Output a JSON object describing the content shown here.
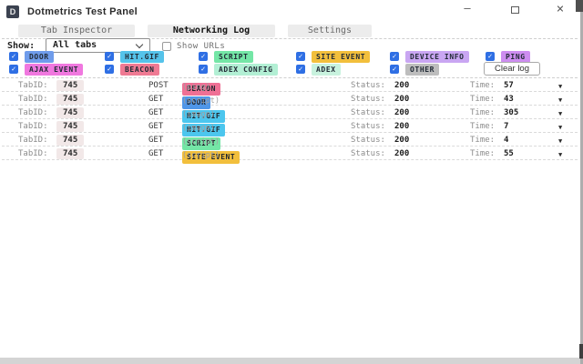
{
  "window": {
    "title": "Dotmetrics Test Panel",
    "icon_letter": "D",
    "controls": {
      "minimize": "—",
      "close": "×"
    }
  },
  "tabs": [
    {
      "label": "Tab Inspector"
    },
    {
      "label": "Networking Log"
    },
    {
      "label": "Settings"
    }
  ],
  "toolbar": {
    "show_label": "Show:",
    "show_select_value": "All tabs",
    "show_urls_label": "Show URLs",
    "clear_log_label": "Clear log",
    "checkmark": "✓"
  },
  "filters": {
    "row1": [
      {
        "label": "DOOR",
        "color": "#6f9ceb"
      },
      {
        "label": "HIT.GIF",
        "color": "#55c3ea"
      },
      {
        "label": "SCRIPT",
        "color": "#74e6a6"
      },
      {
        "label": "SITE EVENT",
        "color": "#f2bf3c"
      },
      {
        "label": "DEVICE INFO",
        "color": "#c9a6f2"
      },
      {
        "label": "PING",
        "color": "#cd8df0"
      }
    ],
    "row2": [
      {
        "label": "AJAX EVENT",
        "color": "#f078df"
      },
      {
        "label": "BEACON",
        "color": "#ef7a93"
      },
      {
        "label": "ADEX CONFIG",
        "color": "#b2efd4"
      },
      {
        "label": "ADEX",
        "color": "#c8f2de"
      },
      {
        "label": "OTHER",
        "color": "#bdbdbd"
      }
    ]
  },
  "log": {
    "tabid_label": "TabID:",
    "status_label": "Status:",
    "time_label": "Time:",
    "rows": [
      {
        "tab_id": "745",
        "method": "POST",
        "type": "BEACON",
        "type_color": "#ef7095",
        "subtype": "(ping)",
        "status": "200",
        "time": "57"
      },
      {
        "tab_id": "745",
        "method": "GET",
        "type": "DOOR",
        "type_color": "#4f96e8",
        "subtype": "(script)",
        "status": "200",
        "time": "43"
      },
      {
        "tab_id": "745",
        "method": "GET",
        "type": "HIT.GIF",
        "type_color": "#4cc6ee",
        "subtype": "(image)",
        "status": "200",
        "time": "305"
      },
      {
        "tab_id": "745",
        "method": "GET",
        "type": "HIT.GIF",
        "type_color": "#4cc6ee",
        "subtype": "(image)",
        "status": "200",
        "time": "7"
      },
      {
        "tab_id": "745",
        "method": "GET",
        "type": "SCRIPT",
        "type_color": "#74e6a6",
        "subtype": "(script)",
        "status": "200",
        "time": "4"
      },
      {
        "tab_id": "745",
        "method": "GET",
        "type": "SITE EVENT",
        "type_color": "#f2bf3c",
        "subtype": "(script)",
        "status": "200",
        "time": "55"
      }
    ]
  }
}
